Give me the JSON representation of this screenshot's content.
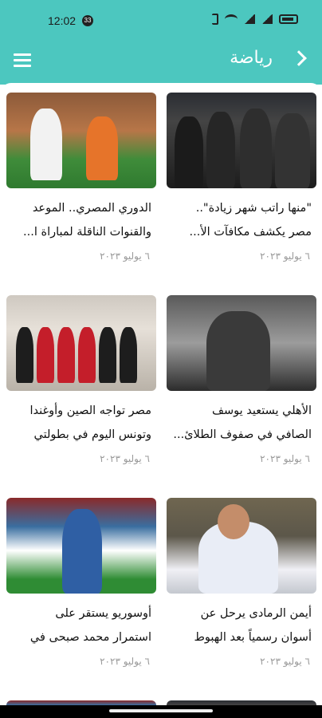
{
  "status": {
    "time": "12:02",
    "badge": "33"
  },
  "header": {
    "title": "رياضة"
  },
  "articles": [
    {
      "line1": "\"منها راتب شهر زيادة\"..",
      "line2": "مصر يكشف مكافآت الأ...",
      "date": "٦ يوليو ٢٠٢٣"
    },
    {
      "line1": "الدوري المصري.. الموعد",
      "line2": "والقنوات الناقلة لمباراة ا...",
      "date": "٦ يوليو ٢٠٢٣"
    },
    {
      "line1": "الأهلي يستعيد يوسف",
      "line2": "الصافي في صفوف الطلائ...",
      "date": "٦ يوليو ٢٠٢٣"
    },
    {
      "line1": "مصر تواجه الصين وأوغندا",
      "line2": "وتونس اليوم في بطولتي",
      "date": "٦ يوليو ٢٠٢٣"
    },
    {
      "line1": "أيمن الرمادى يرحل عن",
      "line2": "أسوان رسمياً بعد الهبوط",
      "date": "٦ يوليو ٢٠٢٣"
    },
    {
      "line1": "أوسوريو يستقر على",
      "line2": "استمرار محمد صبحى في",
      "date": "٦ يوليو ٢٠٢٣"
    }
  ]
}
